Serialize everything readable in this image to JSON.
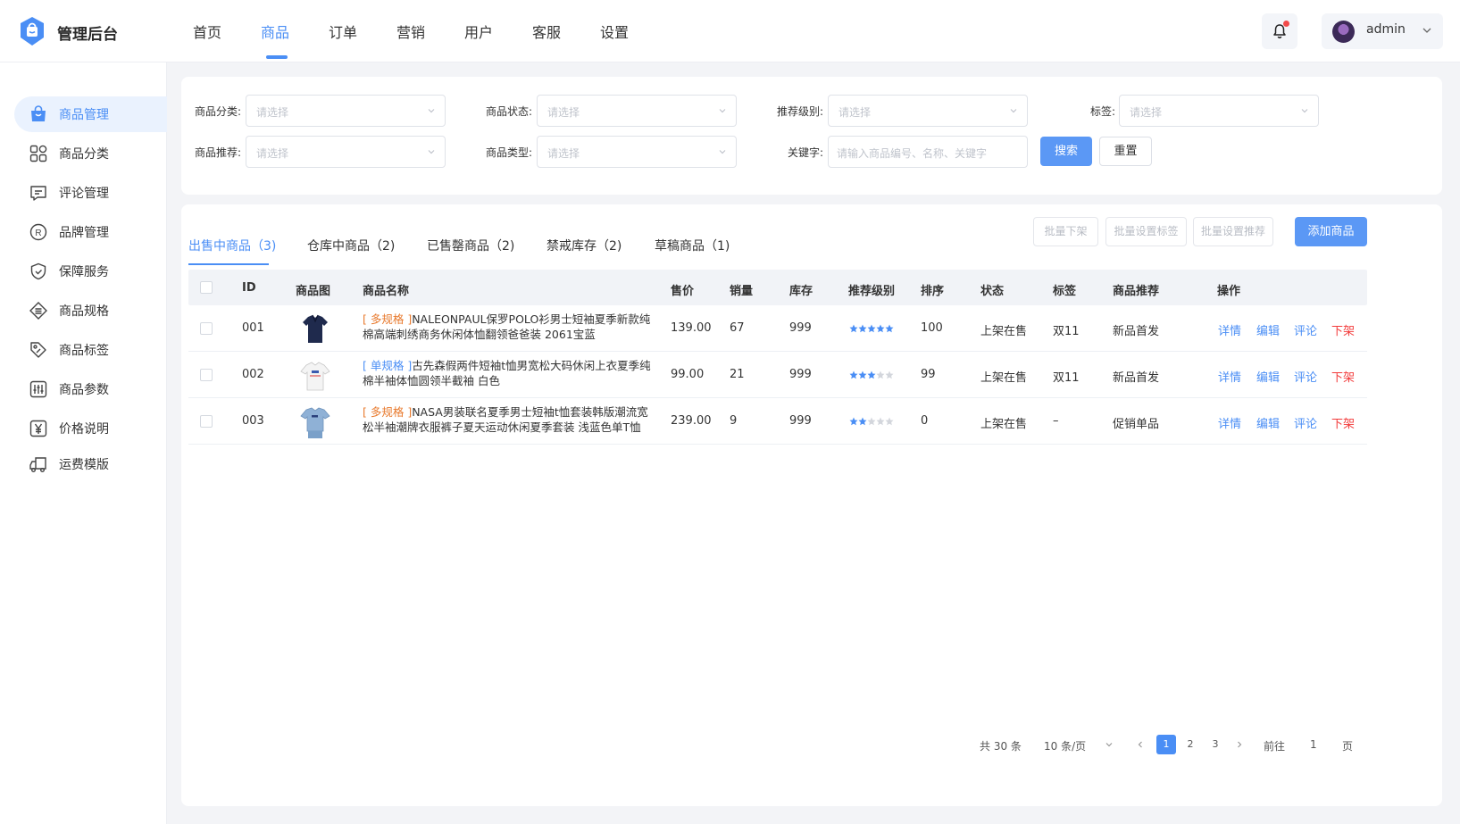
{
  "header": {
    "brand": "管理后台",
    "nav": [
      "首页",
      "商品",
      "订单",
      "营销",
      "用户",
      "客服",
      "设置"
    ],
    "active_nav": "商品",
    "user": "admin"
  },
  "sidebar": {
    "items": [
      {
        "label": "商品管理",
        "icon": "shopping-bag-icon",
        "active": true
      },
      {
        "label": "商品分类",
        "icon": "grid-icon"
      },
      {
        "label": "评论管理",
        "icon": "comment-icon"
      },
      {
        "label": "品牌管理",
        "icon": "registered-icon"
      },
      {
        "label": "保障服务",
        "icon": "shield-icon"
      },
      {
        "label": "商品规格",
        "icon": "spec-icon"
      },
      {
        "label": "商品标签",
        "icon": "tag-icon"
      },
      {
        "label": "商品参数",
        "icon": "sliders-icon"
      },
      {
        "label": "价格说明",
        "icon": "yen-icon"
      },
      {
        "label": "运费模版",
        "icon": "truck-icon"
      }
    ]
  },
  "filter": {
    "category_label": "商品分类:",
    "status_label": "商品状态:",
    "level_label": "推荐级别:",
    "tag_label": "标签:",
    "recommend_label": "商品推荐:",
    "type_label": "商品类型:",
    "keyword_label": "关键字:",
    "select_placeholder": "请选择",
    "keyword_placeholder": "请输入商品编号、名称、关键字",
    "search": "搜索",
    "reset": "重置"
  },
  "tabs": [
    "出售中商品（3)",
    "仓库中商品（2)",
    "已售罄商品（2)",
    "禁戒库存（2)",
    "草稿商品（1)"
  ],
  "actions": {
    "batch_off": "批量下架",
    "batch_tag": "批量设置标签",
    "batch_recommend": "批量设置推荐",
    "add": "添加商品"
  },
  "table": {
    "headers": [
      "ID",
      "商品图",
      "商品名称",
      "售价",
      "销量",
      "库存",
      "推荐级别",
      "排序",
      "状态",
      "标签",
      "商品推荐",
      "操作"
    ],
    "rows": [
      {
        "id": "001",
        "spec": "[ 多规格 ]",
        "spec_type": "multi",
        "name": "NALEONPAUL保罗POLO衫男士短袖夏季新款纯棉高端刺绣商务休闲体恤翻领爸爸装 2061宝蓝",
        "price": "139.00",
        "sales": "67",
        "stock": "999",
        "stars": 5,
        "sort": "100",
        "status": "上架在售",
        "tag": "双11",
        "recommend": "新品首发",
        "thumb": "navy-polo"
      },
      {
        "id": "002",
        "spec": "[ 单规格 ]",
        "spec_type": "single",
        "name": "古先森假两件短袖t恤男宽松大码休闲上衣夏季纯棉半袖体恤圆领半截袖 白色",
        "price": "99.00",
        "sales": "21",
        "stock": "999",
        "stars": 3,
        "sort": "99",
        "status": "上架在售",
        "tag": "双11",
        "recommend": "新品首发",
        "thumb": "white-tee"
      },
      {
        "id": "003",
        "spec": "[ 多规格 ]",
        "spec_type": "multi",
        "name": "NASA男装联名夏季男士短袖t恤套装韩版潮流宽松半袖潮牌衣服裤子夏天运动休闲夏季套装 浅蓝色单T恤",
        "price": "239.00",
        "sales": "9",
        "stock": "999",
        "stars": 2,
        "sort": "0",
        "status": "上架在售",
        "tag": "–",
        "recommend": "促销单品",
        "thumb": "blue-tee"
      }
    ],
    "ops": [
      "详情",
      "编辑",
      "评论",
      "下架"
    ]
  },
  "pagination": {
    "total": "共 30 条",
    "per_page": "10 条/页",
    "pages": [
      "1",
      "2",
      "3"
    ],
    "current": "1",
    "goto": "前往",
    "goto_value": "1",
    "page_unit": "页"
  },
  "colors": {
    "accent": "#4a8ef5",
    "danger": "#f23b3b",
    "orange": "#e8792c"
  }
}
